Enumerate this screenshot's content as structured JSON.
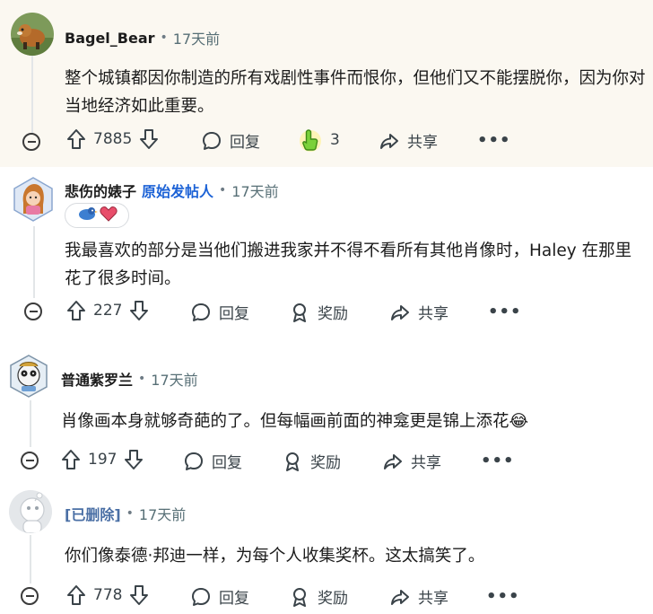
{
  "comments": [
    {
      "author": "Bagel_Bear",
      "time": "17天前",
      "dot": "•",
      "body": "整个城镇都因你制造的所有戏剧性事件而恨你，但他们又不能摆脱你，因为你对当地经济如此重要。",
      "score": "7885",
      "reply_label": "回复",
      "award_count": "3",
      "share_label": "共享",
      "more": "•••"
    },
    {
      "author": "悲伤的婊子",
      "op_badge": "原始发帖人",
      "time": "17天前",
      "dot": "•",
      "body": "我最喜欢的部分是当他们搬进我家并不得不看所有其他肖像时，Haley 在那里花了很多时间。",
      "score": "227",
      "reply_label": "回复",
      "award_label": "奖励",
      "share_label": "共享",
      "more": "•••"
    },
    {
      "author": "普通紫罗兰",
      "time": "17天前",
      "dot": "•",
      "body": "肖像画本身就够奇葩的了。但每幅画前面的神龛更是锦上添花😂",
      "score": "197",
      "reply_label": "回复",
      "award_label": "奖励",
      "share_label": "共享",
      "more": "•••"
    },
    {
      "author": "[已删除]",
      "time": "17天前",
      "dot": "•",
      "body": "你们像泰德·邦迪一样，为每个人收集奖杯。这太搞笑了。",
      "score": "778",
      "reply_label": "回复",
      "award_label": "奖励",
      "share_label": "共享",
      "more": "•••"
    }
  ],
  "colors": {
    "highlight_bg": "#fbf8f1",
    "op_blue": "#1c62d6",
    "text": "#1c1c1c",
    "meta": "#576f76"
  }
}
